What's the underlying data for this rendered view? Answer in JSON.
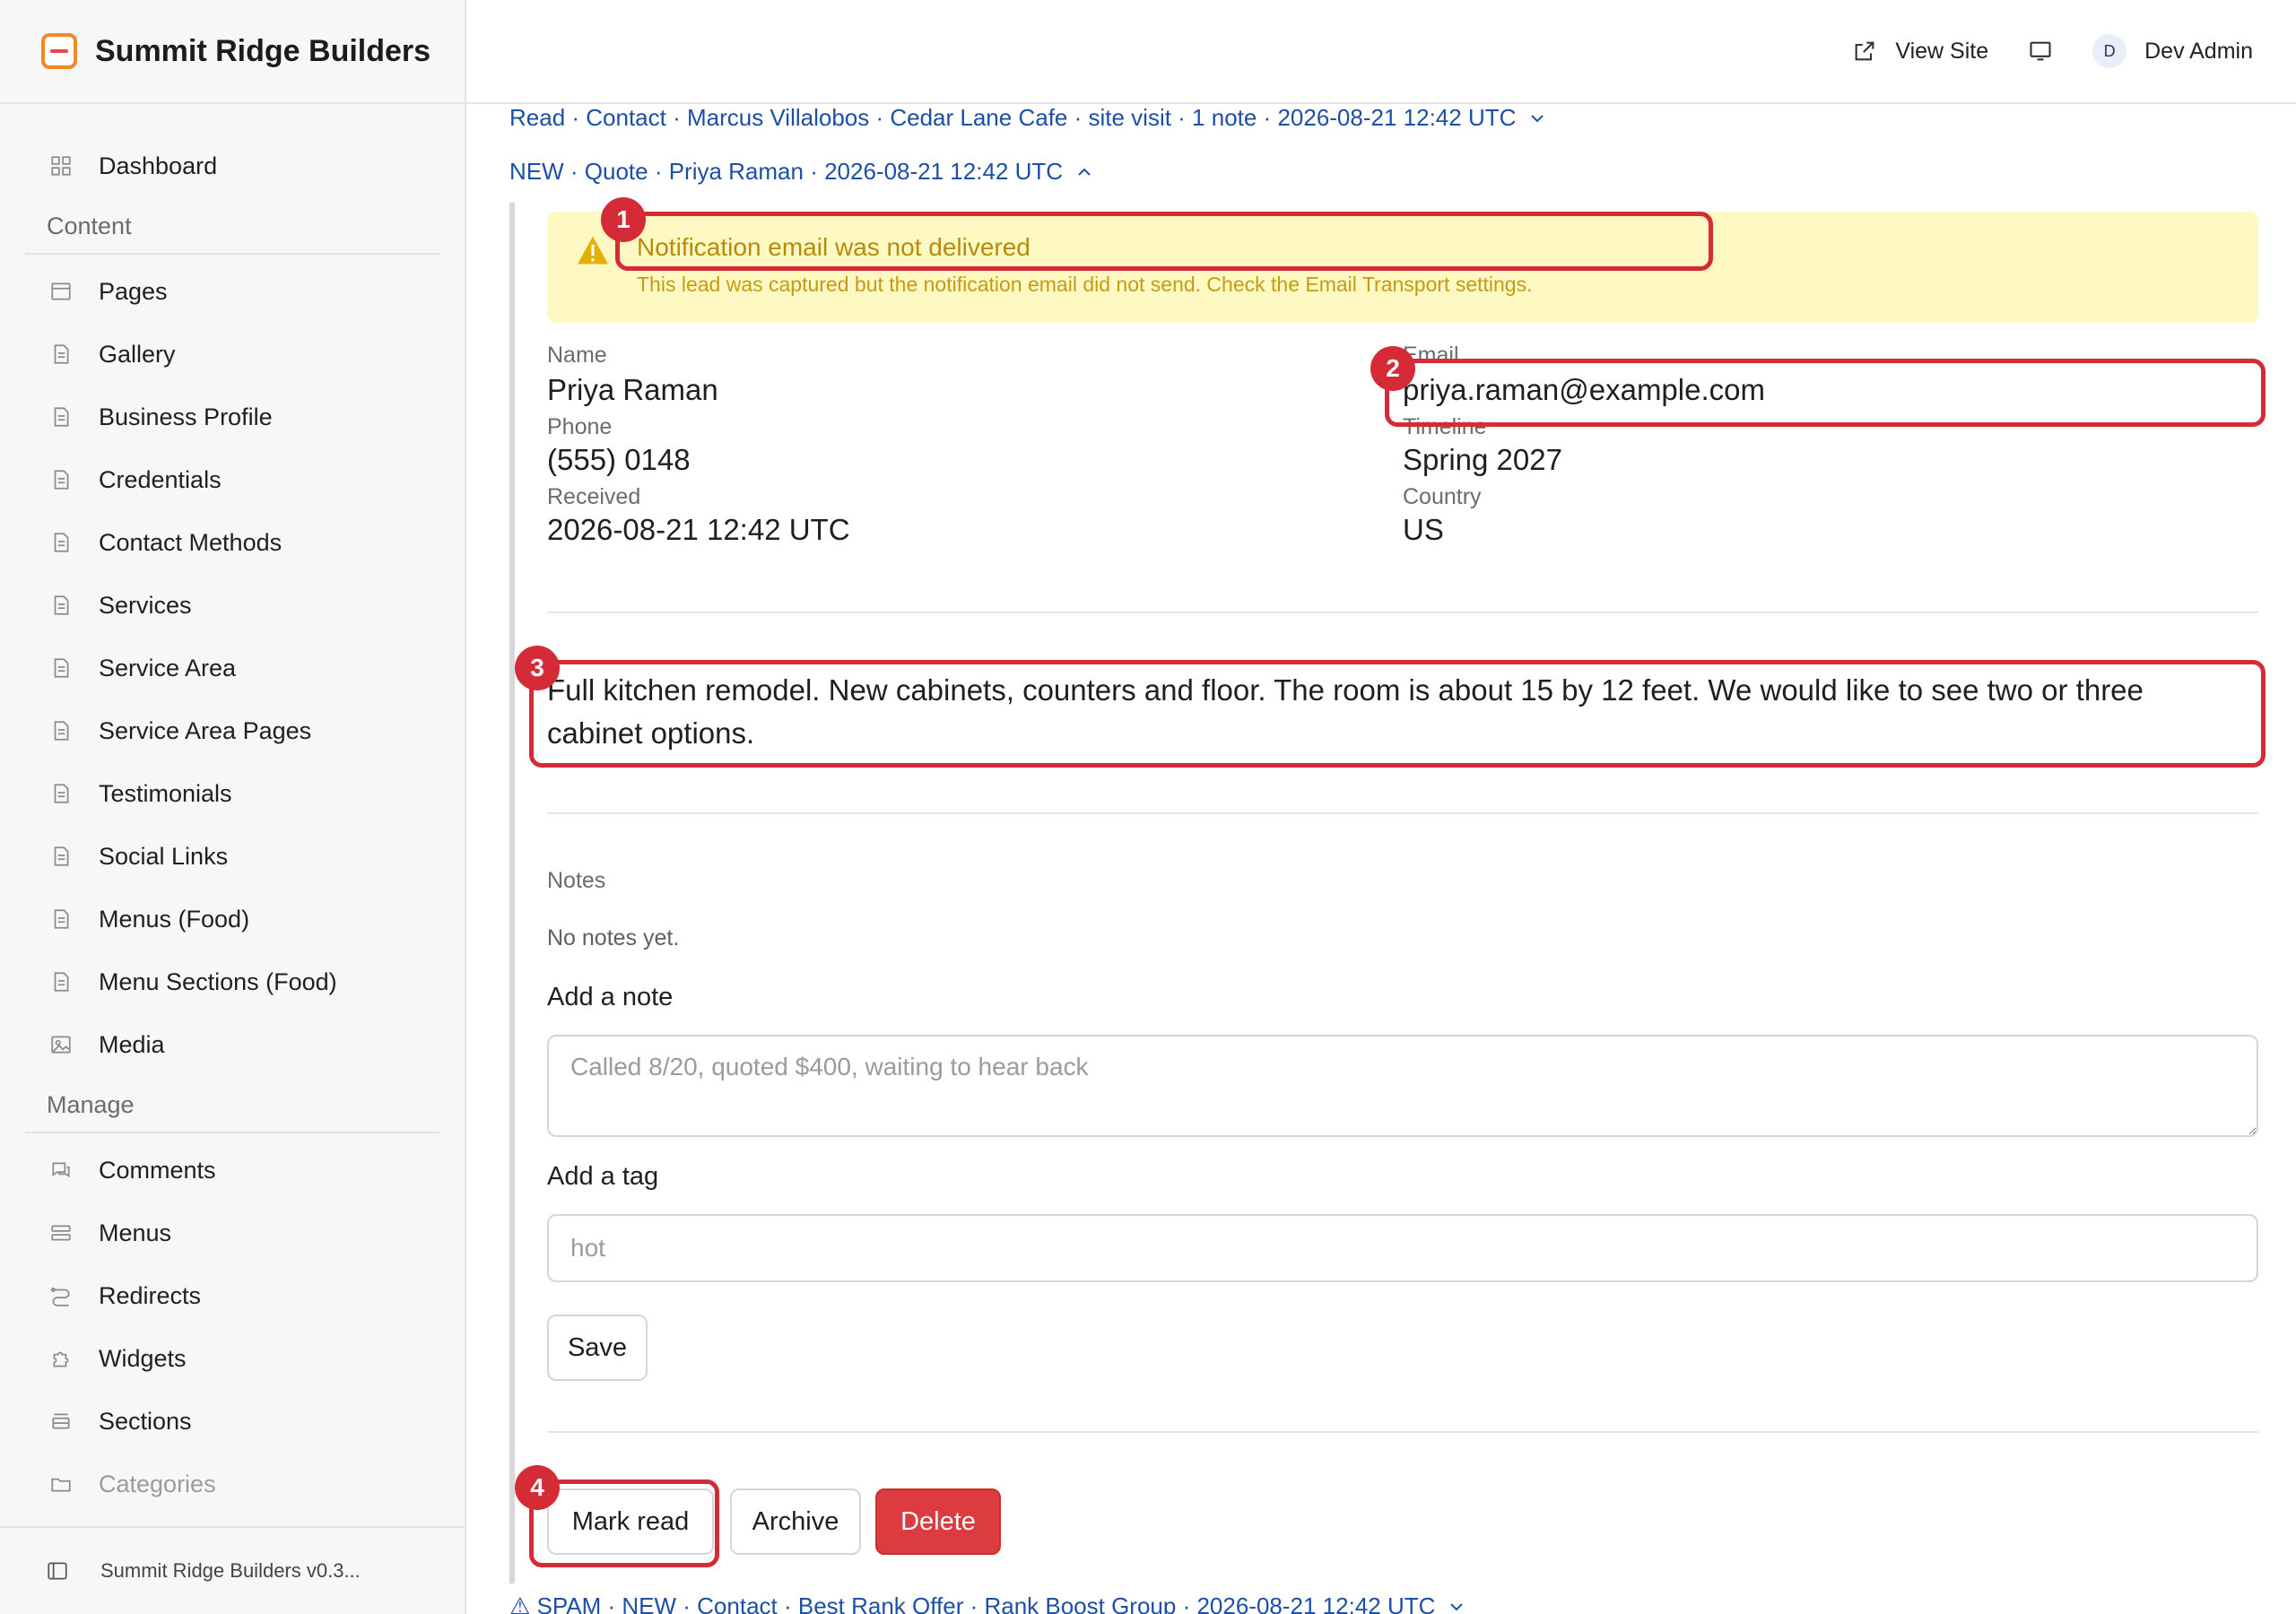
{
  "brand": {
    "name": "Summit Ridge Builders"
  },
  "topbar": {
    "view_site": "View Site",
    "avatar_initial": "D",
    "user": "Dev Admin"
  },
  "sidebar": {
    "dashboard": "Dashboard",
    "content_heading": "Content",
    "content_items": [
      "Pages",
      "Gallery",
      "Business Profile",
      "Credentials",
      "Contact Methods",
      "Services",
      "Service Area",
      "Service Area Pages",
      "Testimonials",
      "Social Links",
      "Menus (Food)",
      "Menu Sections (Food)",
      "Media"
    ],
    "manage_heading": "Manage",
    "manage_items": [
      "Comments",
      "Menus",
      "Redirects",
      "Widgets",
      "Sections",
      "Categories"
    ],
    "footer": "Summit Ridge Builders v0.3..."
  },
  "leads": {
    "collapsed_top": "Read · Contact · Marcus Villalobos · Cedar Lane Cafe · site visit · 1 note · 2026-08-21 12:42 UTC",
    "expanded": "NEW · Quote · Priya Raman · 2026-08-21 12:42 UTC",
    "collapsed_bottom": "⚠ SPAM · NEW · Contact · Best Rank Offer · Rank Boost Group · 2026-08-21 12:42 UTC"
  },
  "alert": {
    "title": "Notification email was not delivered",
    "body": "This lead was captured but the notification email did not send. Check the Email Transport settings."
  },
  "fields": {
    "name_label": "Name",
    "name": "Priya Raman",
    "email_label": "Email",
    "email": "priya.raman@example.com",
    "phone_label": "Phone",
    "phone": "(555) 0148",
    "timeline_label": "Timeline",
    "timeline": "Spring 2027",
    "received_label": "Received",
    "received": "2026-08-21 12:42 UTC",
    "country_label": "Country",
    "country": "US"
  },
  "message": "Full kitchen remodel. New cabinets, counters and floor. The room is about 15 by 12 feet. We would like to see two or three cabinet options.",
  "notes": {
    "label": "Notes",
    "empty": "No notes yet.",
    "add_note_label": "Add a note",
    "add_note_placeholder": "Called 8/20, quoted $400, waiting to hear back",
    "add_tag_label": "Add a tag",
    "add_tag_placeholder": "hot",
    "save": "Save"
  },
  "actions": {
    "mark_read": "Mark read",
    "archive": "Archive",
    "delete": "Delete"
  },
  "annotations": [
    "1",
    "2",
    "3",
    "4"
  ],
  "colors": {
    "accent_link": "#1d4fa6",
    "alert_bg": "#fef9c3",
    "alert_text": "#b98a05",
    "danger": "#dc3b3f",
    "annotation": "#d42b36"
  }
}
